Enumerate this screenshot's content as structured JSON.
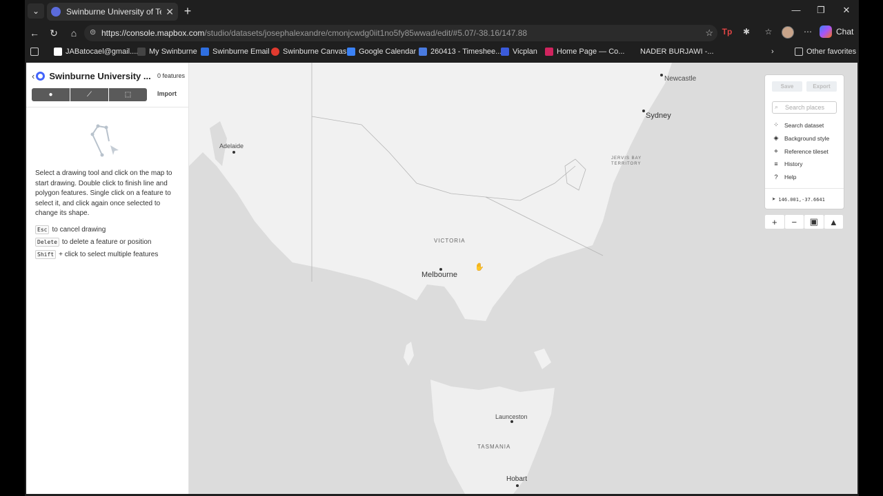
{
  "browser": {
    "tab_title": "Swinburne University of Technology",
    "url_host": "https://console.mapbox.com",
    "url_path": "/studio/datasets/josephalexandre/cmonjcwdg0iit1no5fy85wwad/edit/#5.07/-38.16/147.88",
    "chat_label": "Chat",
    "bookmarks": [
      {
        "label": "JABatocael@gmail....",
        "color": "#ffffff"
      },
      {
        "label": "My Swinburne",
        "color": "#444444"
      },
      {
        "label": "Swinburne Email",
        "color": "#2f6fe0"
      },
      {
        "label": "Swinburne Canvas",
        "color": "#e03a2f"
      },
      {
        "label": "Google Calendar",
        "color": "#3b82f6"
      },
      {
        "label": "260413 - Timeshee...",
        "color": "#4a7be0"
      },
      {
        "label": "Vicplan",
        "color": "#3b5bdb"
      },
      {
        "label": "Home Page — Co...",
        "color": "#d0245e"
      },
      {
        "label": "NADER BURJAWI -...",
        "color": "#1f1f1f"
      }
    ],
    "other_favorites": "Other favorites"
  },
  "sidebar": {
    "title": "Swinburne University ...",
    "feature_count": "0 features",
    "import_label": "Import",
    "instructions": "Select a drawing tool and click on the map to start drawing. Double click to finish line and polygon features. Single click on a feature to select it, and click again once selected to change its shape.",
    "shortcuts": [
      {
        "key": "Esc",
        "text": "to cancel drawing"
      },
      {
        "key": "Delete",
        "text": "to delete a feature or position"
      },
      {
        "key": "Shift",
        "text": "+ click to select multiple features"
      }
    ]
  },
  "panel": {
    "save_label": "Save",
    "export_label": "Export",
    "search_placeholder": "Search places",
    "items": [
      {
        "label": "Search dataset",
        "icon": "search-dataset-icon"
      },
      {
        "label": "Background style",
        "icon": "paint-bucket-icon"
      },
      {
        "label": "Reference tileset",
        "icon": "tileset-icon"
      },
      {
        "label": "History",
        "icon": "history-icon"
      },
      {
        "label": "Help",
        "icon": "help-icon"
      }
    ],
    "cursor_coords": "146.001,-37.6641"
  },
  "map": {
    "cities": [
      {
        "name": "Newcastle"
      },
      {
        "name": "Sydney"
      },
      {
        "name": "Adelaide"
      },
      {
        "name": "Melbourne"
      },
      {
        "name": "Launceston"
      },
      {
        "name": "Hobart"
      }
    ],
    "regions": {
      "victoria": "VICTORIA",
      "tasmania": "TASMANIA",
      "jervis_1": "JERVIS BAY",
      "jervis_2": "TERRITORY"
    }
  }
}
